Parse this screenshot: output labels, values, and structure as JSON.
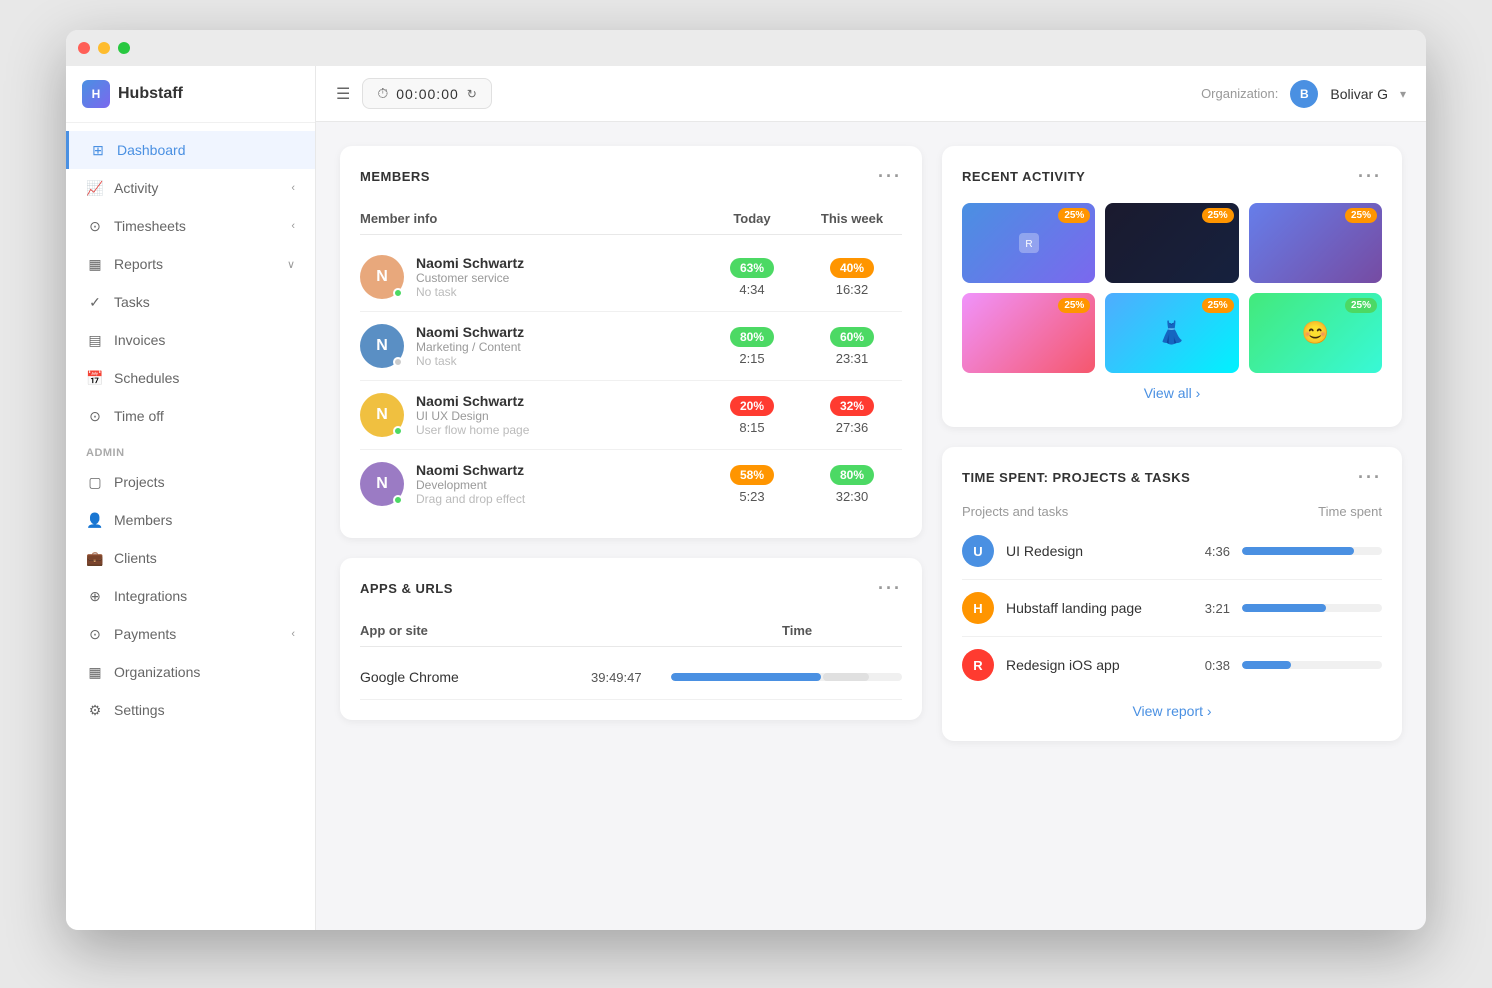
{
  "window": {
    "title": "Hubstaff"
  },
  "topbar": {
    "timer": "00:00:00",
    "org_label": "Organization:",
    "org_initial": "B",
    "org_name": "Bolivar G"
  },
  "sidebar": {
    "brand": "Hubstaff",
    "nav_items": [
      {
        "id": "dashboard",
        "label": "Dashboard",
        "active": true
      },
      {
        "id": "activity",
        "label": "Activity",
        "has_chevron": true
      },
      {
        "id": "timesheets",
        "label": "Timesheets",
        "has_chevron": true
      },
      {
        "id": "reports",
        "label": "Reports",
        "has_chevron": true
      },
      {
        "id": "tasks",
        "label": "Tasks"
      },
      {
        "id": "invoices",
        "label": "Invoices"
      },
      {
        "id": "schedules",
        "label": "Schedules"
      },
      {
        "id": "time-off",
        "label": "Time off"
      }
    ],
    "admin_label": "ADMIN",
    "admin_items": [
      {
        "id": "projects",
        "label": "Projects"
      },
      {
        "id": "members",
        "label": "Members"
      },
      {
        "id": "clients",
        "label": "Clients"
      },
      {
        "id": "integrations",
        "label": "Integrations"
      },
      {
        "id": "payments",
        "label": "Payments",
        "has_chevron": true
      },
      {
        "id": "organizations",
        "label": "Organizations"
      },
      {
        "id": "settings",
        "label": "Settings"
      }
    ]
  },
  "members_card": {
    "title": "MEMBERS",
    "col_member": "Member info",
    "col_today": "Today",
    "col_week": "This week",
    "members": [
      {
        "name": "Naomi Schwartz",
        "dept": "Customer service",
        "task": "No task",
        "today_pct": "63%",
        "today_pct_class": "badge-green",
        "today_time": "4:34",
        "week_pct": "40%",
        "week_pct_class": "badge-orange",
        "week_time": "16:32",
        "status": "green",
        "avatar_color": "#e8a87c"
      },
      {
        "name": "Naomi Schwartz",
        "dept": "Marketing / Content",
        "task": "No task",
        "today_pct": "80%",
        "today_pct_class": "badge-green",
        "today_time": "2:15",
        "week_pct": "60%",
        "week_pct_class": "badge-green",
        "week_time": "23:31",
        "status": "gray",
        "avatar_color": "#5a8fc4"
      },
      {
        "name": "Naomi Schwartz",
        "dept": "UI UX Design",
        "task": "User flow home page",
        "today_pct": "20%",
        "today_pct_class": "badge-red",
        "today_time": "8:15",
        "week_pct": "32%",
        "week_pct_class": "badge-red",
        "week_time": "27:36",
        "status": "green",
        "avatar_color": "#f0c040"
      },
      {
        "name": "Naomi Schwartz",
        "dept": "Development",
        "task": "Drag and drop effect",
        "today_pct": "58%",
        "today_pct_class": "badge-orange",
        "today_time": "5:23",
        "week_pct": "80%",
        "week_pct_class": "badge-green",
        "week_time": "32:30",
        "status": "green",
        "avatar_color": "#9b7bc4"
      }
    ]
  },
  "apps_card": {
    "title": "APPS & URLS",
    "col_app": "App or site",
    "col_time": "Time",
    "apps": [
      {
        "name": "Google Chrome",
        "time": "39:49:47",
        "bar_pct": 65
      }
    ]
  },
  "activity_card": {
    "title": "RECENT ACTIVITY",
    "view_all": "View all",
    "thumbs": [
      {
        "badge": "25%",
        "badge_color": "orange",
        "theme": "thumb-1"
      },
      {
        "badge": "25%",
        "badge_color": "orange",
        "theme": "thumb-2"
      },
      {
        "badge": "25%",
        "badge_color": "orange",
        "theme": "thumb-3"
      },
      {
        "badge": "25%",
        "badge_color": "orange",
        "theme": "thumb-4"
      },
      {
        "badge": "25%",
        "badge_color": "orange",
        "theme": "thumb-5"
      },
      {
        "badge": "25%",
        "badge_color": "green",
        "theme": "thumb-6"
      }
    ]
  },
  "time_spent_card": {
    "title": "TIME SPENT: PROJECTS & TASKS",
    "col_projects": "Projects and tasks",
    "col_time": "Time spent",
    "projects": [
      {
        "name": "UI Redesign",
        "time": "4:36",
        "bar_pct": 80,
        "initial": "U",
        "color": "proj-blue"
      },
      {
        "name": "Hubstaff landing page",
        "time": "3:21",
        "bar_pct": 60,
        "initial": "H",
        "color": "proj-orange"
      },
      {
        "name": "Redesign iOS app",
        "time": "0:38",
        "bar_pct": 35,
        "initial": "R",
        "color": "proj-red"
      }
    ],
    "view_report": "View report"
  }
}
